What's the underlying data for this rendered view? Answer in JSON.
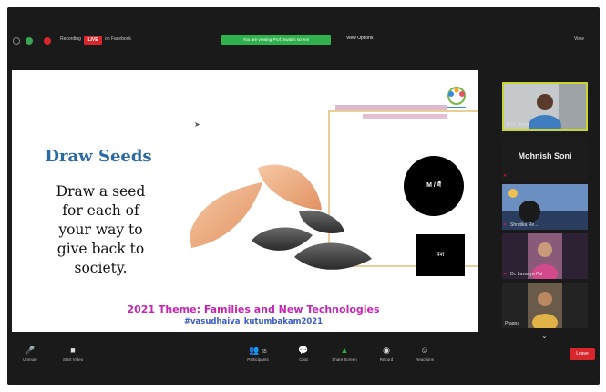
{
  "topbar": {
    "recording_label": "Recording",
    "live_badge": "LIVE",
    "live_destination": "on Facebook",
    "share_banner": "You are viewing Prof. Swati's screen",
    "view_options": "View Options",
    "view_button": "View"
  },
  "slide": {
    "title": "Draw  Seeds",
    "body_lines": [
      "Draw a seed",
      "for each of",
      "your  way to",
      "give back to",
      "society."
    ],
    "circle_label": "M / मैं",
    "box_label": "यश",
    "theme": "2021 Theme: Families and New Technologies",
    "hashtag": "#vasudhaiva_kutumbakam2021"
  },
  "participants": {
    "items": [
      {
        "name": "Prof. Swati"
      },
      {
        "name": "Mohnish Soni"
      },
      {
        "name": "Shrutika Re..."
      },
      {
        "name": "Dr. Lavanya Pal"
      },
      {
        "name": "Pragna"
      }
    ]
  },
  "toolbar": {
    "unmute": "Unmute",
    "start_video": "Start Video",
    "participants": "Participants",
    "participants_count": "65",
    "chat": "Chat",
    "share_screen": "Share Screen",
    "record": "Record",
    "reactions": "Reactions",
    "leave": "Leave"
  },
  "colors": {
    "accent_blue": "#2c6aa5",
    "theme_magenta": "#c526b4",
    "hashtag_blue": "#3b5ac8",
    "live_red": "#d9262c",
    "share_green": "#2fb24b"
  }
}
